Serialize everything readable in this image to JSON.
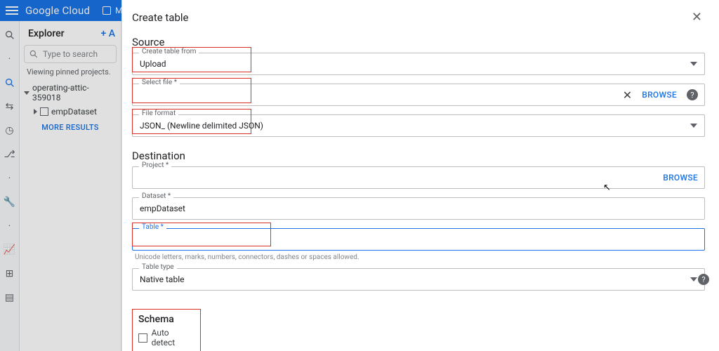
{
  "topbar": {
    "logo": "Google Cloud",
    "project": "My Fi"
  },
  "explorer": {
    "title": "Explorer",
    "add_label": "+ A",
    "search_placeholder": "Type to search",
    "pinned_note": "Viewing pinned projects.",
    "project_name": "operating-attic-359018",
    "dataset_name": "empDataset",
    "more_label": "MORE RESULTS"
  },
  "panel": {
    "title": "Create table",
    "source": {
      "heading": "Source",
      "create_from_label": "Create table from",
      "create_from_value": "Upload",
      "select_file_label": "Select file *",
      "browse": "BROWSE",
      "file_format_label": "File format",
      "file_format_value": "JSON_ (Newline delimited JSON)"
    },
    "destination": {
      "heading": "Destination",
      "project_label": "Project *",
      "browse": "BROWSE",
      "dataset_label": "Dataset *",
      "dataset_value": "empDataset",
      "table_label": "Table *",
      "table_helper": "Unicode letters, marks, numbers, connectors, dashes or spaces allowed.",
      "tabletype_label": "Table type",
      "tabletype_value": "Native table"
    },
    "schema": {
      "heading": "Schema",
      "autodetect": "Auto detect"
    }
  }
}
